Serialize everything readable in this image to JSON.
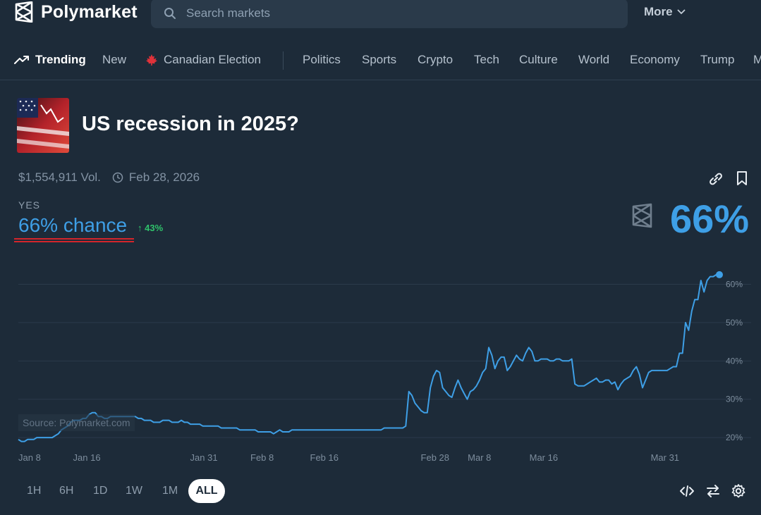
{
  "app": {
    "name": "Polymarket"
  },
  "search": {
    "placeholder": "Search markets"
  },
  "header": {
    "more_label": "More"
  },
  "nav": {
    "items": [
      {
        "label": "Trending",
        "active": true,
        "icon": "trending-icon"
      },
      {
        "label": "New"
      },
      {
        "label": "Canadian Election",
        "icon": "maple-leaf-icon"
      },
      {
        "label": "Politics"
      },
      {
        "label": "Sports"
      },
      {
        "label": "Crypto"
      },
      {
        "label": "Tech"
      },
      {
        "label": "Culture"
      },
      {
        "label": "World"
      },
      {
        "label": "Economy"
      },
      {
        "label": "Trump"
      },
      {
        "label": "M"
      }
    ]
  },
  "market": {
    "title": "US recession in 2025?",
    "volume": "$1,554,911 Vol.",
    "end_date": "Feb 28, 2026",
    "outcome_label": "YES",
    "chance_text": "66% chance",
    "change_text": "↑ 43%",
    "big_percent": "66%"
  },
  "chart_data": {
    "type": "line",
    "series": [
      {
        "values": [
          19.5,
          19,
          19,
          19.5,
          19.5,
          19.5,
          20,
          20,
          20,
          20,
          20,
          20,
          20.5,
          21,
          22,
          22.5,
          23,
          24,
          24.5,
          24.5,
          24.5,
          25,
          25,
          26,
          26.5,
          26.5,
          25.5,
          25.5,
          25,
          25,
          25.5,
          25.5,
          25.5,
          25.5,
          25.5,
          25.5,
          25.5,
          25.5,
          25.5,
          25,
          25,
          24.5,
          24.5,
          24.5,
          24,
          24,
          24,
          24.5,
          24.5,
          24.5,
          24,
          24,
          24,
          24.5,
          24,
          24,
          23.5,
          23.5,
          23.5,
          23.5,
          23,
          23,
          23,
          23,
          23,
          23,
          22.5,
          22.5,
          22.5,
          22.5,
          22.5,
          22.5,
          22,
          22,
          22,
          22,
          22,
          22,
          21.5,
          21.5,
          21.5,
          21.5,
          21.5,
          21,
          21.5,
          22,
          21.5,
          21.5,
          21.5,
          22,
          22,
          22,
          22,
          22,
          22,
          22,
          22,
          22,
          22,
          22,
          22,
          22,
          22,
          22,
          22,
          22,
          22,
          22,
          22,
          22,
          22,
          22,
          22,
          22,
          22,
          22,
          22,
          22,
          22,
          22.5,
          22.5,
          22.5,
          22.5,
          22.5,
          22.5,
          22.5,
          23,
          32,
          31,
          29,
          28,
          27,
          26.5,
          26.5,
          33,
          36,
          37.5,
          37,
          33,
          32,
          31,
          30.5,
          33,
          35,
          33,
          31.5,
          30,
          32,
          32.5,
          33.5,
          35,
          37,
          38,
          43.5,
          41.5,
          38,
          40,
          41,
          41,
          37.5,
          38.5,
          40,
          41.5,
          40.5,
          40,
          42,
          43.5,
          42.5,
          40,
          40,
          40.5,
          40.5,
          40.5,
          40,
          40,
          40.5,
          40.5,
          40,
          40,
          40,
          40.5,
          34,
          33.5,
          33.5,
          33.5,
          34,
          34.5,
          35,
          35.5,
          34.5,
          34.5,
          35,
          35,
          34,
          34.5,
          32.5,
          34,
          35,
          35.5,
          36,
          37.5,
          38.5,
          36.5,
          33,
          35,
          37,
          37.5,
          37.5,
          37.5,
          37.5,
          37.5,
          37.5,
          38,
          38.5,
          38.5,
          42,
          42,
          50,
          48,
          53,
          56,
          56,
          61,
          58,
          61,
          62,
          62,
          62.5,
          62.5
        ]
      }
    ],
    "x_ticks": [
      "Jan 8",
      "Jan 16",
      "Jan 31",
      "Feb 8",
      "Feb 16",
      "Feb 28",
      "Mar 8",
      "Mar 16",
      "Mar 31"
    ],
    "y_ticks": [
      "20%",
      "30%",
      "40%",
      "50%",
      "60%"
    ],
    "ylim": [
      18,
      68
    ],
    "line_color": "#3e9fe6",
    "grid": true,
    "source_text": "Source: Polymarket.com"
  },
  "time_ranges": {
    "items": [
      "1H",
      "6H",
      "1D",
      "1W",
      "1M",
      "ALL"
    ],
    "active": "ALL"
  },
  "colors": {
    "background": "#1d2b39",
    "accent": "#3e9fe6",
    "positive": "#2fc26b",
    "underline": "#d4252b"
  }
}
